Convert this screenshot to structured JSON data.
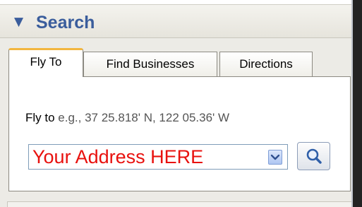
{
  "search_panel": {
    "arrow_glyph": "▼",
    "title": "Search",
    "accent_color": "#3a5d9c"
  },
  "tabs": [
    {
      "label": "Fly To",
      "selected": true
    },
    {
      "label": "Find Businesses",
      "selected": false
    },
    {
      "label": "Directions",
      "selected": false
    }
  ],
  "fly_to": {
    "label": "Fly to",
    "example": "e.g., 37 25.818' N, 122 05.36' W",
    "address_value": "Your Address HERE",
    "address_text_color": "#e8110e",
    "dropdown_icon": "chevron-down-icon",
    "search_icon": "magnifier-icon"
  }
}
